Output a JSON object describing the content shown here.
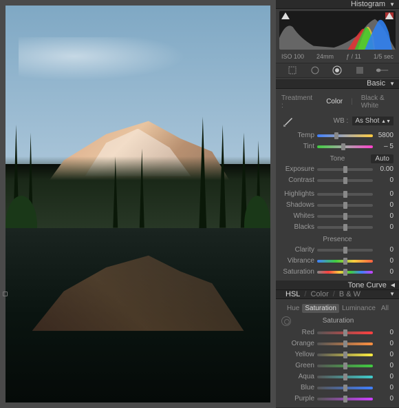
{
  "panels": {
    "histogram": {
      "title": "Histogram"
    },
    "basic": {
      "title": "Basic"
    },
    "tone_curve": {
      "title": "Tone Curve"
    }
  },
  "histogram_info": {
    "iso": "ISO 100",
    "focal": "24mm",
    "aperture": "ƒ / 11",
    "shutter": "1/5 sec"
  },
  "treatment": {
    "label": "Treatment :",
    "color": "Color",
    "bw": "Black & White"
  },
  "wb": {
    "label": "WB :",
    "preset": "As Shot",
    "temp_label": "Temp",
    "temp_value": "5800",
    "tint_label": "Tint",
    "tint_value": "– 5"
  },
  "tone": {
    "heading": "Tone",
    "auto": "Auto",
    "exposure_label": "Exposure",
    "exposure_value": "0.00",
    "contrast_label": "Contrast",
    "contrast_value": "0",
    "highlights_label": "Highlights",
    "highlights_value": "0",
    "shadows_label": "Shadows",
    "shadows_value": "0",
    "whites_label": "Whites",
    "whites_value": "0",
    "blacks_label": "Blacks",
    "blacks_value": "0"
  },
  "presence": {
    "heading": "Presence",
    "clarity_label": "Clarity",
    "clarity_value": "0",
    "vibrance_label": "Vibrance",
    "vibrance_value": "0",
    "saturation_label": "Saturation",
    "saturation_value": "0"
  },
  "hsl": {
    "tabs": {
      "hsl": "HSL",
      "color": "Color",
      "bw": "B & W"
    },
    "subtabs": {
      "hue": "Hue",
      "saturation": "Saturation",
      "luminance": "Luminance",
      "all": "All"
    },
    "heading": "Saturation",
    "red_label": "Red",
    "red_value": "0",
    "orange_label": "Orange",
    "orange_value": "0",
    "yellow_label": "Yellow",
    "yellow_value": "0",
    "green_label": "Green",
    "green_value": "0",
    "aqua_label": "Aqua",
    "aqua_value": "0",
    "blue_label": "Blue",
    "blue_value": "0",
    "purple_label": "Purple",
    "purple_value": "0"
  }
}
